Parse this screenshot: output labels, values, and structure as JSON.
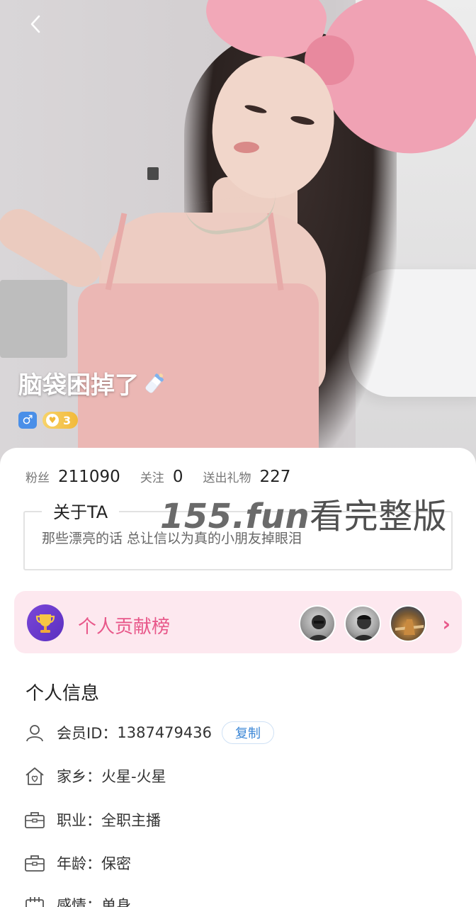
{
  "profile": {
    "nickname": "脑袋困掉了",
    "gender_symbol": "♂",
    "level": "3"
  },
  "stats": {
    "fans_label": "粉丝",
    "fans_value": "211090",
    "follow_label": "关注",
    "follow_value": "0",
    "gifts_label": "送出礼物",
    "gifts_value": "227"
  },
  "about": {
    "title": "关于TA",
    "text": "那些漂亮的话 总让信以为真的小朋友掉眼泪"
  },
  "watermark": {
    "site": "155.fun",
    "text": "看完整版"
  },
  "contribution": {
    "label": "个人贡献榜",
    "chevron": "›"
  },
  "personal_info": {
    "title": "个人信息",
    "member_id_label": "会员ID：",
    "member_id_value": "1387479436",
    "copy_label": "复制",
    "hometown_label": "家乡：",
    "hometown_value": "火星-火星",
    "job_label": "职业：",
    "job_value": "全职主播",
    "age_label": "年龄：",
    "age_value": "保密",
    "relationship_label": "感情：",
    "relationship_value": "单身"
  },
  "icons": {
    "back": "back-arrow-icon",
    "bottle": "baby-bottle-emoji",
    "trophy": "trophy-icon",
    "member": "user-icon",
    "hometown": "house-heart-icon",
    "job": "briefcase-icon",
    "age": "briefcase-icon",
    "relationship": "calendar-icon"
  },
  "colors": {
    "accent_pink": "#e8588a",
    "contrib_bg": "#fde8ef",
    "copy_blue": "#3a86d6",
    "gender_blue": "#4a8fe8",
    "level_gold": "#f2b93a"
  }
}
